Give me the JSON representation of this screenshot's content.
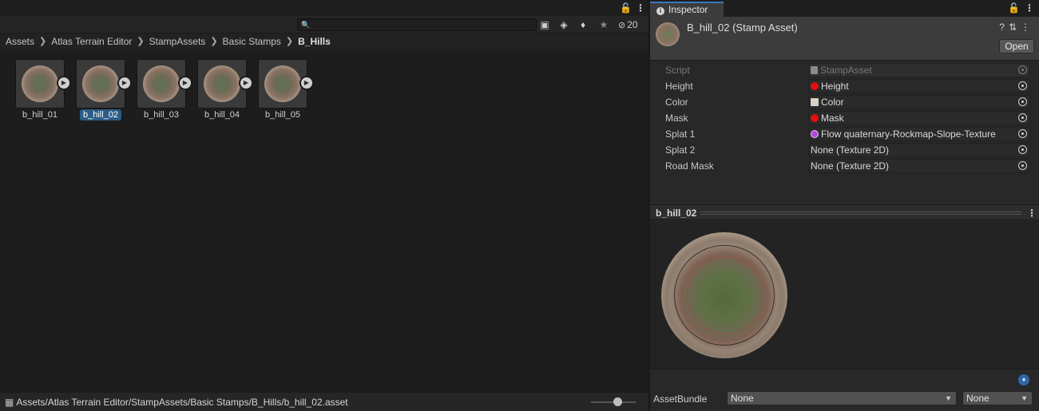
{
  "project": {
    "search": {
      "placeholder": ""
    },
    "hidden_count": "20",
    "breadcrumb": [
      "Assets",
      "Atlas Terrain Editor",
      "StampAssets",
      "Basic Stamps",
      "B_Hills"
    ],
    "assets": [
      {
        "label": "b_hill_01",
        "selected": false
      },
      {
        "label": "b_hill_02",
        "selected": true
      },
      {
        "label": "b_hill_03",
        "selected": false
      },
      {
        "label": "b_hill_04",
        "selected": false
      },
      {
        "label": "b_hill_05",
        "selected": false
      }
    ],
    "status_path": "Assets/Atlas Terrain Editor/StampAssets/Basic Stamps/B_Hills/b_hill_02.asset",
    "zoom_level": 0.6
  },
  "inspector": {
    "tab_label": "Inspector",
    "title": "B_hill_02 (Stamp Asset)",
    "open_label": "Open",
    "properties": [
      {
        "label": "Script",
        "value": "StampAsset",
        "disabled": true,
        "swatch": "script"
      },
      {
        "label": "Height",
        "value": "Height",
        "swatch": "#e01010"
      },
      {
        "label": "Color",
        "value": "Color",
        "swatch": "#d8d0c0"
      },
      {
        "label": "Mask",
        "value": "Mask",
        "swatch": "#e01010"
      },
      {
        "label": "Splat 1",
        "value": "Flow quaternary-Rockmap-Slope-Texture",
        "swatch": "#b04ad8"
      },
      {
        "label": "Splat 2",
        "value": "None (Texture 2D)",
        "swatch": ""
      },
      {
        "label": "Road Mask",
        "value": "None (Texture 2D)",
        "swatch": ""
      }
    ],
    "preview_title": "b_hill_02",
    "asset_bundle_label": "AssetBundle",
    "bundle_name": "None",
    "bundle_variant": "None"
  },
  "colors": {
    "accent": "#3a79bb",
    "selection": "#2c5d87"
  }
}
